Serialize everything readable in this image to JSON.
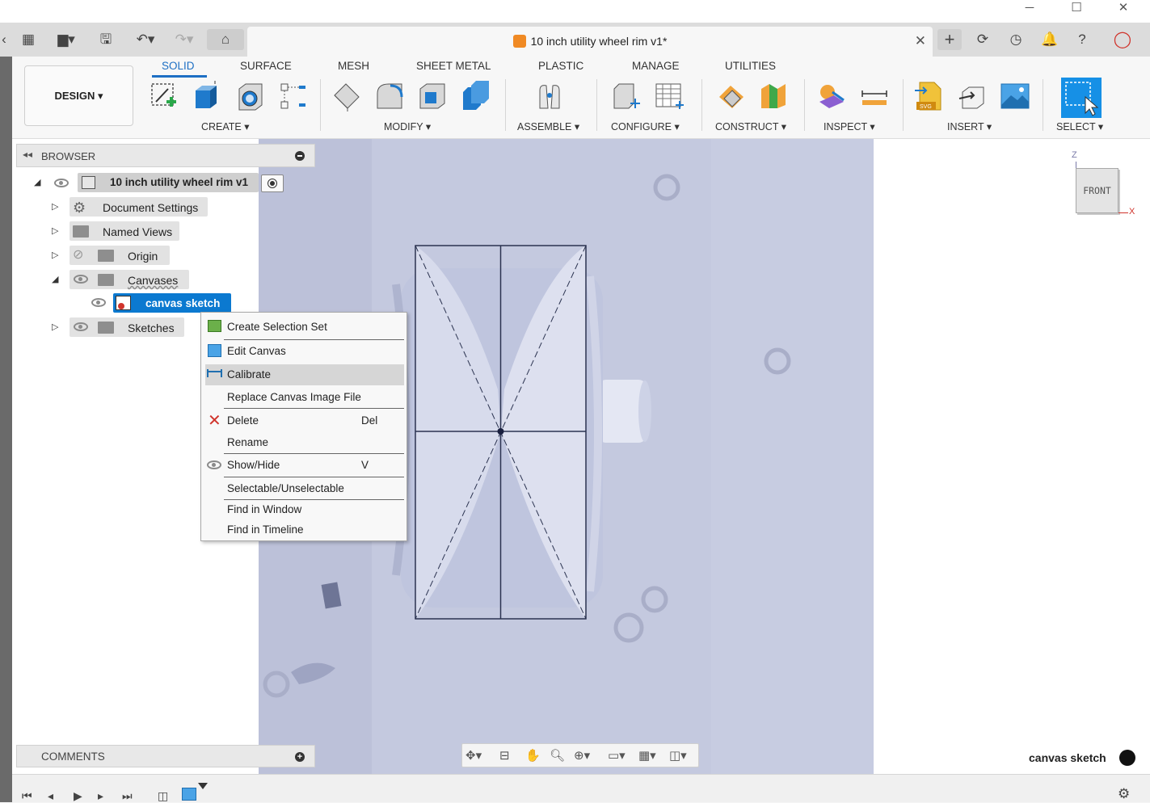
{
  "window": {
    "title": "10 inch utility wheel rim v1*",
    "controls": [
      "─",
      "☐",
      "✕"
    ]
  },
  "toolbar": {
    "workspace": "DESIGN ▾",
    "tabs": [
      "SOLID",
      "SURFACE",
      "MESH",
      "SHEET METAL",
      "PLASTIC",
      "MANAGE",
      "UTILITIES"
    ],
    "groups": [
      "CREATE ▾",
      "MODIFY ▾",
      "ASSEMBLE ▾",
      "CONFIGURE ▾",
      "CONSTRUCT ▾",
      "INSPECT ▾",
      "INSERT ▾",
      "SELECT ▾"
    ],
    "accent": "#1d6fc4"
  },
  "browser": {
    "title": "BROWSER",
    "root": "10 inch utility wheel rim v1",
    "items": [
      {
        "label": "Document Settings",
        "icon": "gear-icon"
      },
      {
        "label": "Named Views",
        "icon": "folder-icon"
      },
      {
        "label": "Origin",
        "icon": "folder-icon"
      },
      {
        "label": "Canvases",
        "icon": "folder-icon"
      },
      {
        "label": "canvas sketch",
        "icon": "canvas-icon"
      },
      {
        "label": "Sketches",
        "icon": "folder-icon"
      }
    ]
  },
  "context_menu": {
    "items": [
      {
        "label": "Create Selection Set",
        "shortcut": ""
      },
      {
        "label": "Edit Canvas",
        "shortcut": ""
      },
      {
        "label": "Calibrate",
        "shortcut": ""
      },
      {
        "label": "Replace Canvas Image File",
        "shortcut": ""
      },
      {
        "label": "Delete",
        "shortcut": "Del"
      },
      {
        "label": "Rename",
        "shortcut": ""
      },
      {
        "label": "Show/Hide",
        "shortcut": "V"
      },
      {
        "label": "Selectable/Unselectable",
        "shortcut": ""
      },
      {
        "label": "Find in Window",
        "shortcut": ""
      },
      {
        "label": "Find in Timeline",
        "shortcut": ""
      }
    ],
    "highlighted": "Calibrate"
  },
  "comments": {
    "title": "COMMENTS"
  },
  "viewcube": {
    "face": "FRONT",
    "axis_z": "Z",
    "axis_x": "X"
  },
  "status": {
    "selection": "canvas sketch"
  }
}
